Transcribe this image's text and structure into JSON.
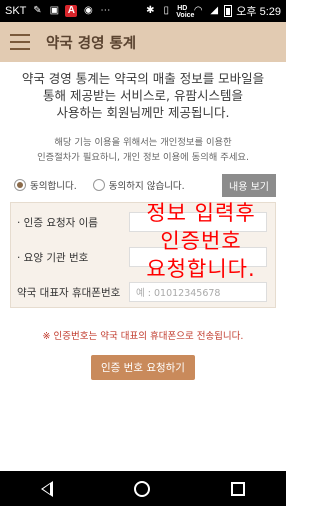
{
  "status_bar": {
    "carrier": "SKT",
    "badge": "A",
    "network_label": "HD Voice",
    "time": "오후 5:29"
  },
  "app_bar": {
    "title": "약국 경영 통계"
  },
  "intro": {
    "line1": "약국 경영 통계는 약국의 매출 정보를 모바일을",
    "line2": "통해 제공받는 서비스로, 유팜시스템을",
    "line3": "사용하는 회원님께만 제공됩니다."
  },
  "notice": {
    "line1": "해당 기능 이용을 위해서는 개인정보를 이용한",
    "line2": "인증절차가 필요하니, 개인 정보 이용에 동의해 주세요."
  },
  "consent": {
    "agree_label": "동의합니다.",
    "disagree_label": "동의하지 않습니다.",
    "view_button": "내용 보기",
    "selected": "agree"
  },
  "form": {
    "requester_label": "· 인증 요청자 이름",
    "institution_label": "· 요양 기관 번호",
    "phone_label": "약국 대표자 휴대폰번호",
    "phone_placeholder": "예 : 01012345678"
  },
  "overlay": {
    "line1": "정보 입력후",
    "line2": "인증번호",
    "line3": "요청합니다."
  },
  "warning": "※ 인증번호는 약국 대표의 휴대폰으로 전송됩니다.",
  "submit_label": "인증 번호 요청하기",
  "colors": {
    "app_bar": "#e2cbb2",
    "accent": "#c98a5b",
    "warning": "#c0392b",
    "overlay": "#ff0000"
  }
}
